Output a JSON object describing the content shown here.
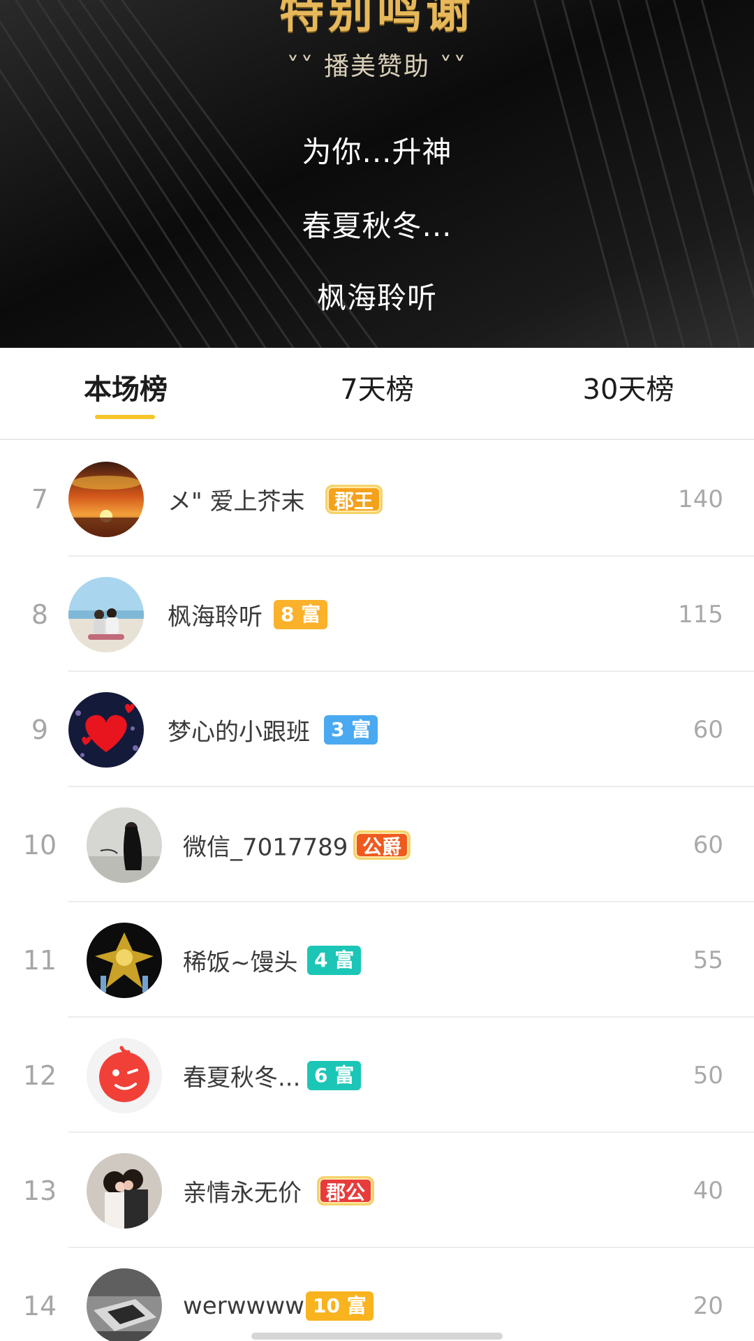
{
  "banner": {
    "title": "特别鸣谢",
    "subtitle": "˅˅ 播美赞助 ˅˅",
    "names": [
      "为你...升神",
      "春夏秋冬...",
      "枫海聆听"
    ]
  },
  "tabs": [
    {
      "label": "本场榜",
      "active": true
    },
    {
      "label": "7天榜",
      "active": false
    },
    {
      "label": "30天榜",
      "active": false
    }
  ],
  "accent_color": "#f7c52a",
  "rows": [
    {
      "rank": "7",
      "name": "メ\" 爱上芥末",
      "badge": "郡王",
      "badge_color": "#f4a21d",
      "score": "140",
      "avatar_icon": "sunset-avatar"
    },
    {
      "rank": "8",
      "name": "枫海聆听",
      "badge": "8 富",
      "badge_color": "#fbb12a",
      "score": "115",
      "avatar_icon": "couple-beach-avatar"
    },
    {
      "rank": "9",
      "name": "梦心的小跟班",
      "badge": "3 富",
      "badge_color": "#4aa9f0",
      "score": "60",
      "avatar_icon": "heart-avatar"
    },
    {
      "rank": "10",
      "name": "微信_7017789",
      "badge": "公爵",
      "badge_color": "#ef5a1f",
      "score": "60",
      "avatar_icon": "woman-avatar"
    },
    {
      "rank": "11",
      "name": "稀饭~馒头",
      "badge": "4 富",
      "badge_color": "#1cc6b6",
      "score": "55",
      "avatar_icon": "golden-warrior-avatar"
    },
    {
      "rank": "12",
      "name": "春夏秋冬...",
      "badge": "6 富",
      "badge_color": "#1cc6b6",
      "score": "50",
      "avatar_icon": "wink-face-avatar"
    },
    {
      "rank": "13",
      "name": "亲情永无价",
      "badge": "郡公",
      "badge_color": "#e83b3b",
      "score": "40",
      "avatar_icon": "kissing-couple-avatar"
    },
    {
      "rank": "14",
      "name": "werwwww",
      "badge": "10 富",
      "badge_color": "#f8b31f",
      "score": "20",
      "avatar_icon": "room-avatar"
    }
  ]
}
